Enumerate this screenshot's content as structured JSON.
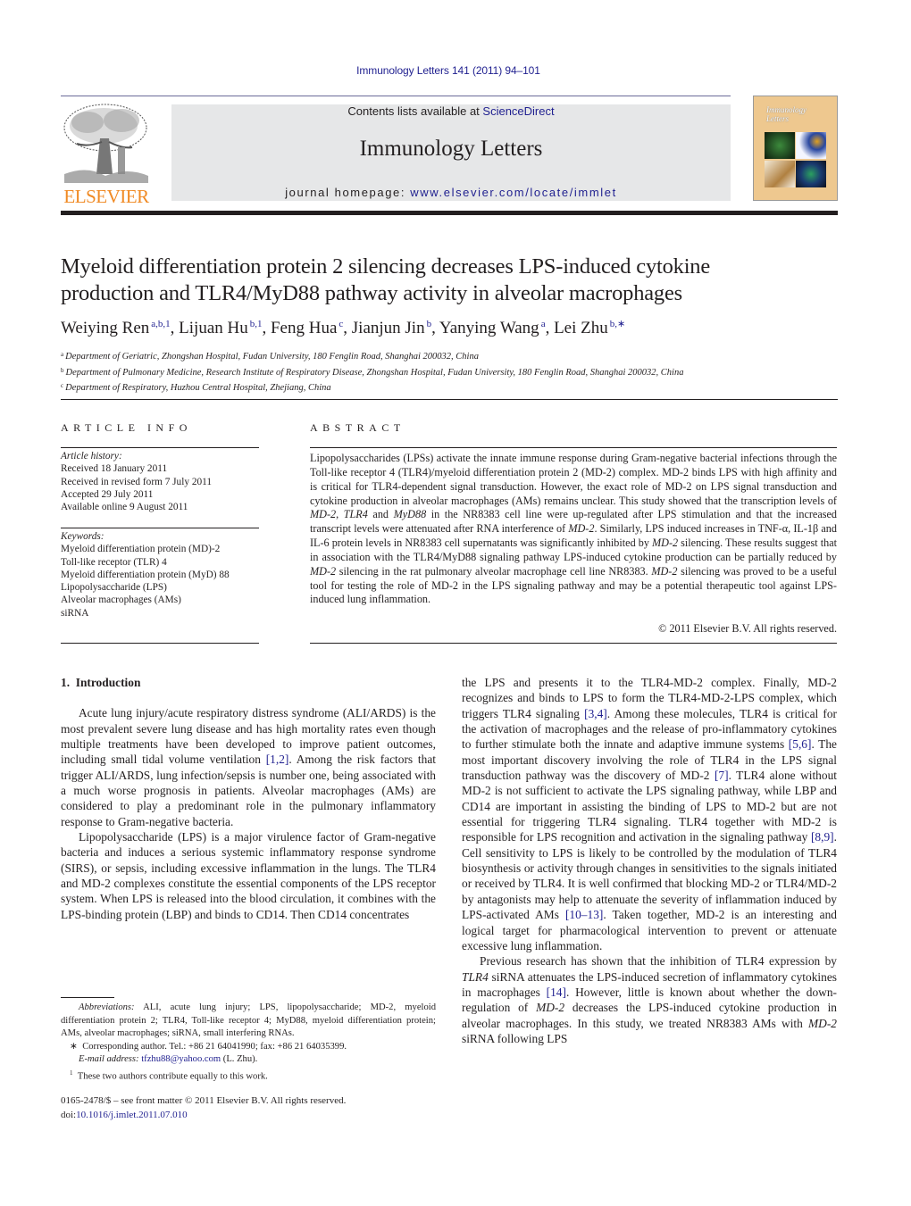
{
  "header": {
    "journal_ref": "Immunology Letters 141 (2011) 94–101",
    "contents_prefix": "Contents lists available at ",
    "contents_link": "ScienceDirect",
    "journal_title": "Immunology Letters",
    "homepage_prefix": "journal homepage: ",
    "homepage_link": "www.elsevier.com/locate/immlet",
    "publisher_logo": "ELSEVIER",
    "cover_title": "Immunology Letters",
    "colors": {
      "link": "#1f1f8f",
      "elsevier_orange": "#f08a24",
      "masthead_gray": "#e6e7e8",
      "cover_tan": "#eec88f"
    }
  },
  "article": {
    "title_line1": "Myeloid differentiation protein 2 silencing decreases LPS-induced cytokine",
    "title_line2": "production and TLR4/MyD88 pathway activity in alveolar macrophages",
    "authors": [
      {
        "name": "Weiying Ren",
        "sup": "a,b,1"
      },
      {
        "name": "Lijuan Hu",
        "sup": "b,1"
      },
      {
        "name": "Feng Hua",
        "sup": "c"
      },
      {
        "name": "Jianjun Jin",
        "sup": "b"
      },
      {
        "name": "Yanying Wang",
        "sup": "a"
      },
      {
        "name": "Lei Zhu",
        "sup": "b,∗"
      }
    ],
    "affiliations": [
      {
        "mark": "a",
        "text": "Department of Geriatric, Zhongshan Hospital, Fudan University, 180 Fenglin Road, Shanghai 200032, China"
      },
      {
        "mark": "b",
        "text": "Department of Pulmonary Medicine, Research Institute of Respiratory Disease, Zhongshan Hospital, Fudan University, 180 Fenglin Road, Shanghai 200032, China"
      },
      {
        "mark": "c",
        "text": "Department of Respiratory, Huzhou Central Hospital, Zhejiang, China"
      }
    ]
  },
  "article_info": {
    "heading": "ARTICLE INFO",
    "history_label": "Article history:",
    "history": [
      "Received 18 January 2011",
      "Received in revised form 7 July 2011",
      "Accepted 29 July 2011",
      "Available online 9 August 2011"
    ],
    "keywords_label": "Keywords:",
    "keywords": [
      "Myeloid differentiation protein (MD)-2",
      "Toll-like receptor (TLR) 4",
      "Myeloid differentiation protein (MyD) 88",
      "Lipopolysaccharide (LPS)",
      "Alveolar macrophages (AMs)",
      "siRNA"
    ]
  },
  "abstract": {
    "heading": "ABSTRACT",
    "parts": [
      "Lipopolysaccharides (LPSs) activate the innate immune response during Gram-negative bacterial infections through the Toll-like receptor 4 (TLR4)/myeloid differentiation protein 2 (MD-2) complex. MD-2 binds LPS with high affinity and is critical for TLR4-dependent signal transduction. However, the exact role of MD-2 on LPS signal transduction and cytokine production in alveolar macrophages (AMs) remains unclear. This study showed that the transcription levels of ",
      "MD-2",
      ", ",
      "TLR4",
      " and ",
      "MyD88",
      " in the NR8383 cell line were up-regulated after LPS stimulation and that the increased transcript levels were attenuated after RNA interference of ",
      "MD-2",
      ". Similarly, LPS induced increases in TNF-α, IL-1β and IL-6 protein levels in NR8383 cell supernatants was significantly inhibited by ",
      "MD-2",
      " silencing. These results suggest that in association with the TLR4/MyD88 signaling pathway LPS-induced cytokine production can be partially reduced by ",
      "MD-2",
      " silencing in the rat pulmonary alveolar macrophage cell line NR8383. ",
      "MD-2",
      " silencing was proved to be a useful tool for testing the role of MD-2 in the LPS signaling pathway and may be a potential therapeutic tool against LPS-induced lung inflammation."
    ],
    "copyright": "© 2011 Elsevier B.V. All rights reserved."
  },
  "body": {
    "section_heading": "1.  Introduction",
    "left_p1": {
      "a": "Acute lung injury/acute respiratory distress syndrome (ALI/ARDS) is the most prevalent severe lung disease and has high mortality rates even though multiple treatments have been developed to improve patient outcomes, including small tidal volume ventilation ",
      "ref1": "[1,2]",
      "b": ". Among the risk factors that trigger ALI/ARDS, lung infection/sepsis is number one, being associated with a much worse prognosis in patients. Alveolar macrophages (AMs) are considered to play a predominant role in the pulmonary inflammatory response to Gram-negative bacteria."
    },
    "left_p2": "Lipopolysaccharide (LPS) is a major virulence factor of Gram-negative bacteria and induces a serious systemic inflammatory response syndrome (SIRS), or sepsis, including excessive inflammation in the lungs. The TLR4 and MD-2 complexes constitute the essential components of the LPS receptor system. When LPS is released into the blood circulation, it combines with the LPS-binding protein (LBP) and binds to CD14. Then CD14 concentrates",
    "right_p1": {
      "a": "the LPS and presents it to the TLR4-MD-2 complex. Finally, MD-2 recognizes and binds to LPS to form the TLR4-MD-2-LPS complex, which triggers TLR4 signaling ",
      "ref1": "[3,4]",
      "b": ". Among these molecules, TLR4 is critical for the activation of macrophages and the release of pro-inflammatory cytokines to further stimulate both the innate and adaptive immune systems ",
      "ref2": "[5,6]",
      "c": ". The most important discovery involving the role of TLR4 in the LPS signal transduction pathway was the discovery of MD-2 ",
      "ref3": "[7]",
      "d": ". TLR4 alone without MD-2 is not sufficient to activate the LPS signaling pathway, while LBP and CD14 are important in assisting the binding of LPS to MD-2 but are not essential for triggering TLR4 signaling. TLR4 together with MD-2 is responsible for LPS recognition and activation in the signaling pathway ",
      "ref4": "[8,9]",
      "e": ". Cell sensitivity to LPS is likely to be controlled by the modulation of TLR4 biosynthesis or activity through changes in sensitivities to the signals initiated or received by TLR4. It is well confirmed that blocking MD-2 or TLR4/MD-2 by antagonists may help to attenuate the severity of inflammation induced by LPS-activated AMs ",
      "ref5": "[10–13]",
      "f": ". Taken together, MD-2 is an interesting and logical target for pharmacological intervention to prevent or attenuate excessive lung inflammation."
    },
    "right_p2": {
      "a": "Previous research has shown that the inhibition of TLR4 expression by ",
      "it1": "TLR4",
      "b": " siRNA attenuates the LPS-induced secretion of inflammatory cytokines in macrophages ",
      "ref1": "[14]",
      "c": ". However, little is known about whether the down-regulation of ",
      "it2": "MD-2",
      "d": " decreases the LPS-induced cytokine production in alveolar macrophages. In this study, we treated NR8383 AMs with ",
      "it3": "MD-2",
      "e": " siRNA following LPS"
    }
  },
  "footnotes": {
    "abbrev_label": "Abbreviations:",
    "abbrev_text": " ALI, acute lung injury; LPS, lipopolysaccharide; MD-2, myeloid differentiation protein 2; TLR4, Toll-like receptor 4; MyD88, myeloid differentiation protein; AMs, alveolar macrophages; siRNA, small interfering RNAs.",
    "corresponding_mark": "∗",
    "corresponding_text": "Corresponding author. Tel.: +86 21 64041990; fax: +86 21 64035399.",
    "email_label": "E-mail address:",
    "email": "tfzhu88@yahoo.com",
    "email_suffix": " (L. Zhu).",
    "equal_mark": "1",
    "equal_text": "These two authors contribute equally to this work."
  },
  "bottom": {
    "issn_line": "0165-2478/$ – see front matter © 2011 Elsevier B.V. All rights reserved.",
    "doi_prefix": "doi:",
    "doi": "10.1016/j.imlet.2011.07.010"
  }
}
